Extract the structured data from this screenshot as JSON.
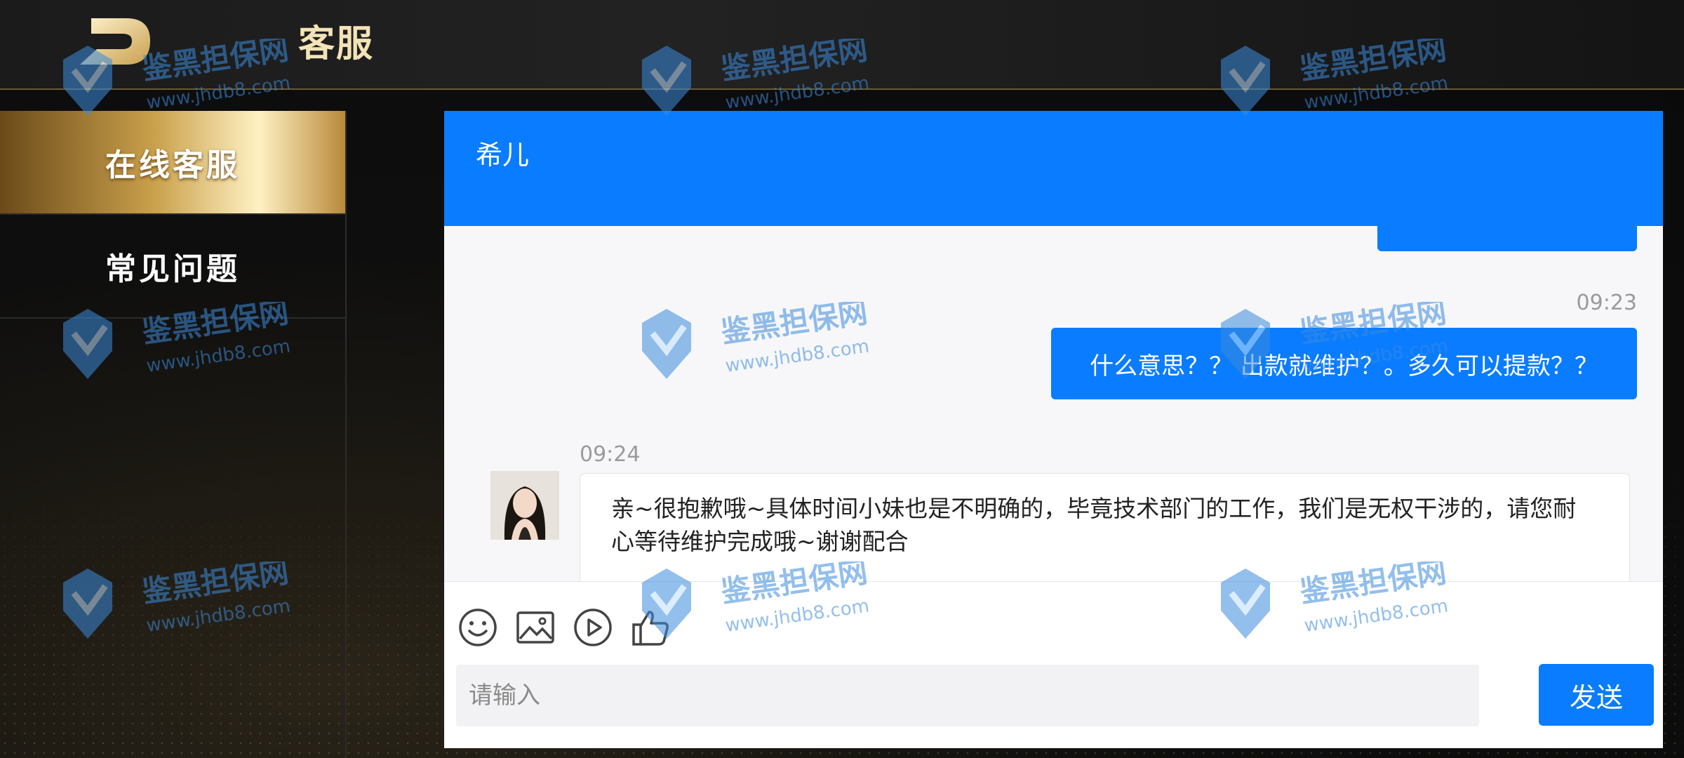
{
  "header": {
    "title": "客服"
  },
  "sidebar": {
    "items": [
      {
        "label": "在线客服",
        "active": true
      },
      {
        "label": "常见问题",
        "active": false
      }
    ]
  },
  "chat": {
    "agent_name": "希儿",
    "messages": [
      {
        "from": "user",
        "time": "09:23",
        "text": "什么意思？？ 出款就维护？。多久可以提款？？"
      },
      {
        "from": "agent",
        "time": "09:24",
        "text": "亲~很抱歉哦~具体时间小妹也是不明确的，毕竟技术部门的工作，我们是无权干涉的，请您耐心等待维护完成哦~谢谢配合"
      }
    ],
    "toolbar": [
      "smile-icon",
      "image-icon",
      "play-icon",
      "thumbs-up-icon"
    ],
    "input_placeholder": "请输入",
    "send_label": "发送"
  },
  "watermark": {
    "brand": "鉴黑担保网",
    "url": "www.jhdb8.com"
  },
  "colors": {
    "accent": "#0a7cff",
    "gold": "#caa14c",
    "bubble_in": "#ffffff"
  }
}
